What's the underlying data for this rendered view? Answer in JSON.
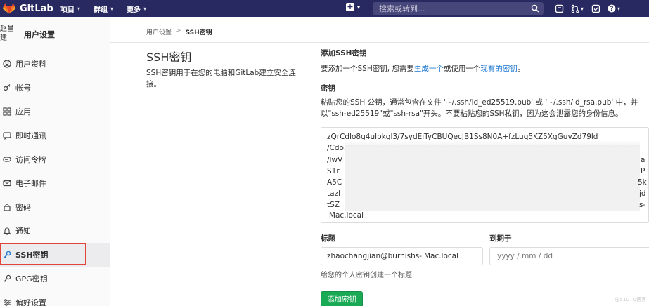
{
  "navbar": {
    "brand": "GitLab",
    "menu": [
      {
        "label": "项目"
      },
      {
        "label": "群组"
      },
      {
        "label": "更多"
      }
    ],
    "search_placeholder": "搜索或转到...",
    "colors": {
      "background": "#292961",
      "logo_orange": "#e24329"
    }
  },
  "sidebar": {
    "user_name": "赵昌建",
    "title": "用户设置",
    "items": [
      {
        "label": "用户资料",
        "icon": "user-circle-icon"
      },
      {
        "label": "帐号",
        "icon": "key-icon"
      },
      {
        "label": "应用",
        "icon": "applications-icon"
      },
      {
        "label": "即时通讯",
        "icon": "chat-icon"
      },
      {
        "label": "访问令牌",
        "icon": "token-icon"
      },
      {
        "label": "电子邮件",
        "icon": "mail-icon"
      },
      {
        "label": "密码",
        "icon": "lock-icon"
      },
      {
        "label": "通知",
        "icon": "bell-icon"
      },
      {
        "label": "SSH密钥",
        "icon": "key-icon",
        "active": true
      },
      {
        "label": "GPG密钥",
        "icon": "key-icon"
      },
      {
        "label": "偏好设置",
        "icon": "preferences-icon"
      }
    ]
  },
  "breadcrumb": {
    "parent": "用户设置",
    "separator": ">",
    "current": "SSH密钥"
  },
  "section": {
    "title": "SSH密钥",
    "description": "SSH密钥用于在您的电脑和GitLab建立安全连接。"
  },
  "form": {
    "add_title": "添加SSH密钥",
    "add_desc_prefix": "要添加一个SSH密钥, 您需要",
    "add_desc_link1": "生成一个",
    "add_desc_middle": "或使用一个",
    "add_desc_link2": "现有的密钥",
    "add_desc_suffix": "。",
    "key_label": "密钥",
    "key_help": "粘贴您的SSH 公钥，通常包含在文件 '~/.ssh/id_ed25519.pub' 或 '~/.ssh/id_rsa.pub' 中，并以\"ssh-ed25519\"或\"ssh-rsa\"开头。不要粘贴您的SSH私钥，因为这会泄露您的身份信息。",
    "key_lines": [
      "zQrCdlo8g4ulpkql3/7sydEiTyCBUQecJB1Ss8N0A+fzLuq5KZ5XgGuvZd79ld",
      "/Cdo...",
      "/lwV",
      "S1r",
      "A5C",
      "tazl",
      "tSZ",
      "iMac.local"
    ],
    "key_right_fragments": [
      "a",
      "P",
      "5k",
      "jd",
      "s-"
    ],
    "title_label": "标题",
    "title_value": "zhaochangjian@burnishs-iMac.local",
    "expires_label": "到期于",
    "expires_placeholder": "yyyy / mm / dd",
    "title_help": "给您的个人密钥创建一个标题.",
    "submit_label": "添加密钥"
  },
  "watermark": "@51CTO博客"
}
